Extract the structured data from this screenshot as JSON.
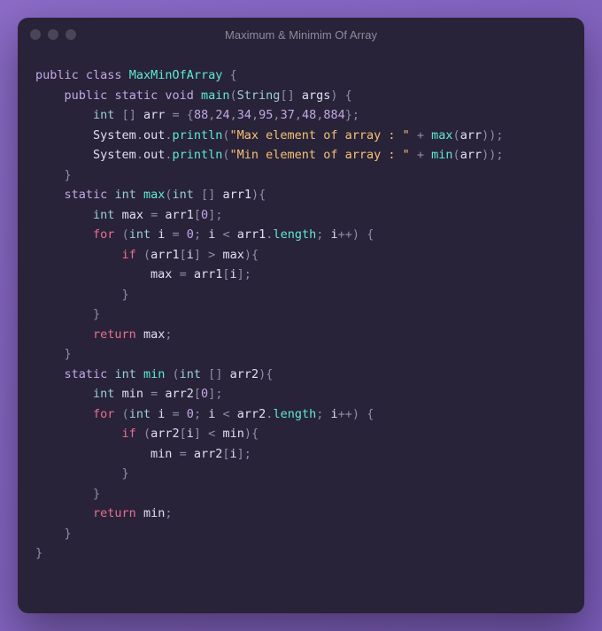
{
  "window": {
    "title": "Maximum & Minimim Of Array"
  },
  "tokens": {
    "public": "public",
    "class": "class",
    "static": "static",
    "void": "void",
    "for": "for",
    "if": "if",
    "return": "return",
    "int": "int",
    "String": "String",
    "className": "MaxMinOfArray",
    "main": "main",
    "args": "args",
    "arr": "arr",
    "arr1": "arr1",
    "arr2": "arr2",
    "System": "System",
    "out": "out",
    "println": "println",
    "maxFn": "max",
    "minFn": "min",
    "maxVar": "max",
    "minVar": "min",
    "length": "length",
    "i": "i",
    "zero": "0",
    "n88": "88",
    "n24": "24",
    "n34": "34",
    "n95": "95",
    "n37": "37",
    "n48": "48",
    "n884": "884",
    "strMax": "\"Max element of array : \"",
    "strMin": "\"Min element of array : \"",
    "lbrace": "{",
    "rbrace": "}",
    "lparen": "(",
    "rparen": ")",
    "lbrack": "[",
    "rbrack": "]",
    "semi": ";",
    "comma": ",",
    "dot": ".",
    "eq": "=",
    "lt": "<",
    "gt": ">",
    "plus": "+",
    "pp": "++"
  }
}
